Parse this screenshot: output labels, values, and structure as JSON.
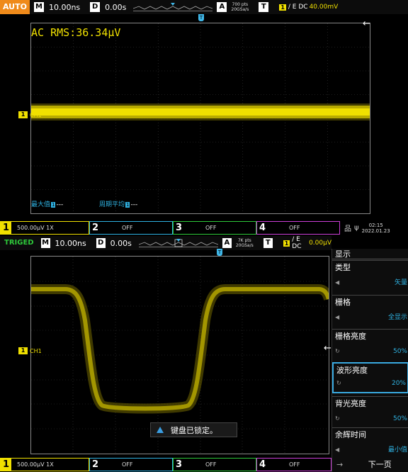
{
  "top": {
    "mode": "AUTO",
    "m_label": "M",
    "timebase": "10.00ns",
    "d_label": "D",
    "delay": "0.00s",
    "a_label": "A",
    "pts_line1": "700 pts",
    "pts_line2": "20GSa/s",
    "t_label": "T",
    "trig_ch": "1",
    "trig_text": "/ E DC",
    "trig_level": "40.00mV",
    "measurement": "AC RMS:36.34µV",
    "ch_marker": "1",
    "ch_label": "CH1",
    "trig_point_label": "T",
    "meas_max_label": "最大值",
    "meas_max_box": "1",
    "meas_max_value": "---",
    "meas_cyc_label": "周期平均",
    "meas_cyc_box": "1",
    "meas_cyc_value": "---",
    "chan1_num": "1",
    "chan1_text": "500.00µV 1X",
    "chan2_num": "2",
    "chan2_text": "OFF",
    "chan3_num": "3",
    "chan3_text": "OFF",
    "chan4_num": "4",
    "chan4_text": "OFF",
    "clock_time": "02:15",
    "clock_date": "2022.01.23"
  },
  "bottom": {
    "mode": "TRIGED",
    "m_label": "M",
    "timebase": "10.00ns",
    "d_label": "D",
    "delay": "0.00s",
    "a_label": "A",
    "pts_line1": "7K pts",
    "pts_line2": "20GSa/s",
    "t_label": "T",
    "trig_ch": "1",
    "trig_text": "/ E DC",
    "trig_level": "0.00µV",
    "ch_marker": "1",
    "ch_label": "CH1",
    "trig_point_label": "T",
    "toast": "键盘已锁定。",
    "chan1_num": "1",
    "chan1_text": "500.00µV 1X",
    "chan2_num": "2",
    "chan2_text": "OFF",
    "chan3_num": "3",
    "chan3_text": "OFF",
    "chan4_num": "4",
    "chan4_text": "OFF"
  },
  "menu": {
    "title": "显示",
    "items": [
      {
        "label": "类型",
        "value": "矢量"
      },
      {
        "label": "栅格",
        "value": "全显示"
      },
      {
        "label": "栅格亮度",
        "value": "50%"
      },
      {
        "label": "波形亮度",
        "value": "20%"
      },
      {
        "label": "背光亮度",
        "value": "50%"
      },
      {
        "label": "余辉时间",
        "value": "最小值"
      }
    ],
    "next_page": "下一页"
  },
  "colors": {
    "ch1": "#f0e000",
    "ch2": "#2fb2e2",
    "ch3": "#2ec93a",
    "ch4": "#cc3fd8",
    "auto_badge": "#ef8a1a",
    "triged": "#2ec93a"
  }
}
